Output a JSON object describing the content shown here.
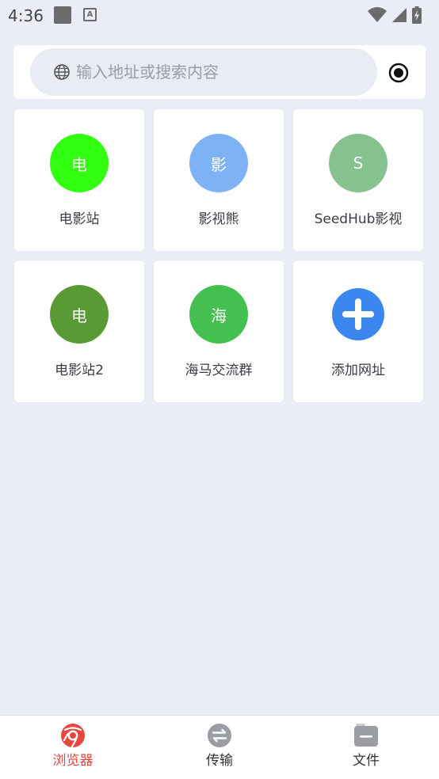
{
  "status_bar": {
    "time": "4:36",
    "notification_letter": "A"
  },
  "search": {
    "placeholder": "输入地址或搜索内容"
  },
  "tiles": [
    {
      "initial": "电",
      "label": "电影站",
      "color": "#33ff11"
    },
    {
      "initial": "影",
      "label": "影视熊",
      "color": "#7db3f5"
    },
    {
      "initial": "S",
      "label": "SeedHub影视",
      "color": "#85c28f"
    },
    {
      "initial": "电",
      "label": "电影站2",
      "color": "#5a9a35"
    },
    {
      "initial": "海",
      "label": "海马交流群",
      "color": "#43c04f"
    },
    {
      "initial": "",
      "label": "添加网址",
      "color": "#3c86f0"
    }
  ],
  "bottom_nav": {
    "items": [
      {
        "label": "浏览器",
        "icon": "browser-icon",
        "active": true
      },
      {
        "label": "传输",
        "icon": "transfer-icon",
        "active": false
      },
      {
        "label": "文件",
        "icon": "file-icon",
        "active": false
      }
    ]
  },
  "colors": {
    "background": "#eaedf5",
    "accent": "#e8453c"
  }
}
